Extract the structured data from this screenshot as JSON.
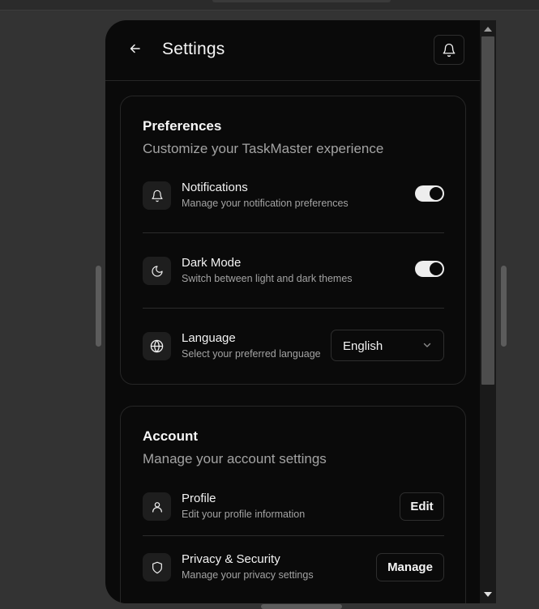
{
  "header": {
    "title": "Settings",
    "back_icon": "arrow-left-icon",
    "bell_icon": "bell-icon"
  },
  "preferences": {
    "title": "Preferences",
    "subtitle": "Customize your TaskMaster experience",
    "notifications": {
      "label": "Notifications",
      "description": "Manage your notification preferences",
      "icon": "bell-icon",
      "enabled": true
    },
    "dark_mode": {
      "label": "Dark Mode",
      "description": "Switch between light and dark themes",
      "icon": "moon-icon",
      "enabled": true
    },
    "language": {
      "label": "Language",
      "description": "Select your preferred language",
      "icon": "globe-icon",
      "selected": "English"
    }
  },
  "account": {
    "title": "Account",
    "subtitle": "Manage your account settings",
    "profile": {
      "label": "Profile",
      "description": "Edit your profile information",
      "icon": "user-icon",
      "button": "Edit"
    },
    "privacy": {
      "label": "Privacy & Security",
      "description": "Manage your privacy settings",
      "icon": "shield-icon",
      "button": "Manage"
    }
  },
  "colors": {
    "background": "#0a0a0a",
    "card_border": "#262626",
    "text_primary": "#f2f2f2",
    "text_muted": "#a3a3a3",
    "toggle_on": "#ededed"
  }
}
